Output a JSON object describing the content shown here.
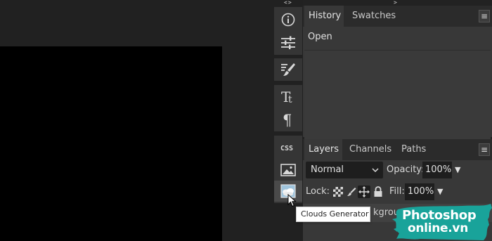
{
  "top_handles": {
    "left": "<>",
    "right": "><"
  },
  "tools": [
    {
      "name": "info-icon"
    },
    {
      "name": "adjustments-icon"
    },
    {
      "name": "brush-settings-icon"
    },
    {
      "name": "character-icon"
    },
    {
      "name": "paragraph-icon"
    },
    {
      "name": "css-icon",
      "label": "CSS"
    },
    {
      "name": "image-icon"
    },
    {
      "name": "clouds-generator-icon"
    }
  ],
  "history_panel": {
    "tabs": [
      "History",
      "Swatches"
    ],
    "active_tab": "History",
    "menu_glyph": "≡",
    "items": [
      "Open"
    ]
  },
  "layers_panel": {
    "tabs": [
      "Layers",
      "Channels",
      "Paths"
    ],
    "active_tab": "Layers",
    "menu_glyph": "≡",
    "blend_mode": "Normal",
    "opacity_label": "Opacity:",
    "opacity_value": "100%",
    "lock_label": "Lock:",
    "fill_label": "Fill:",
    "fill_value": "100%",
    "dropdown_glyph": "▼",
    "layer_name_partial": "kgroun"
  },
  "tooltip": "Clouds Generator",
  "watermark": {
    "line1": "Photoshop",
    "line2": "online.vn"
  },
  "colors": {
    "canvas_bg": "#212121",
    "document": "#000000",
    "panel": "#383838",
    "tabbar": "#2b2b2b",
    "logo_teal": "#19a39a"
  }
}
